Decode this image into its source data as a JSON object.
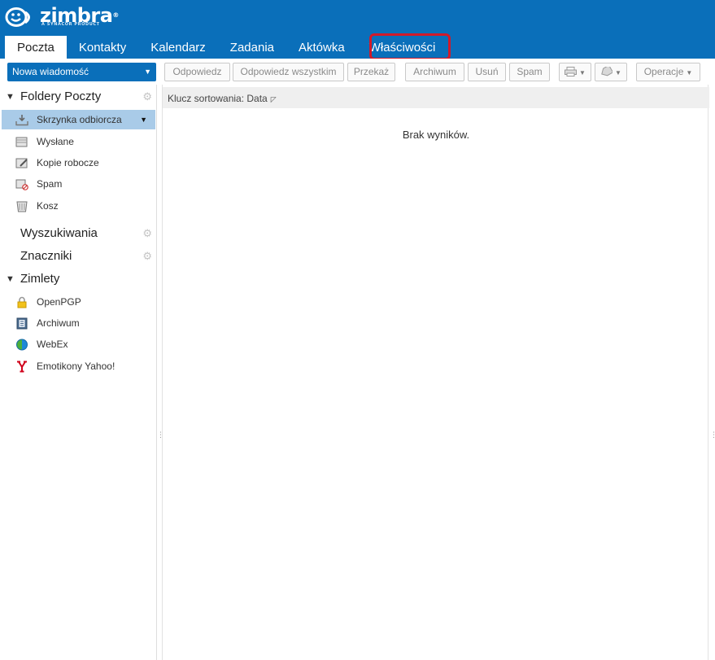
{
  "brand": {
    "name": "zimbra",
    "registered": "®",
    "tagline": "A SYNACOR PRODUCT",
    "color": "#0a6fba"
  },
  "tabs": [
    {
      "label": "Poczta",
      "active": true
    },
    {
      "label": "Kontakty",
      "active": false
    },
    {
      "label": "Kalendarz",
      "active": false
    },
    {
      "label": "Zadania",
      "active": false
    },
    {
      "label": "Aktówka",
      "active": false
    },
    {
      "label": "Właściwości",
      "active": false,
      "highlighted": true
    }
  ],
  "toolbar": {
    "new_message": "Nowa wiadomość",
    "reply": "Odpowiedz",
    "reply_all": "Odpowiedz wszystkim",
    "forward": "Przekaż",
    "archive": "Archiwum",
    "delete": "Usuń",
    "spam": "Spam",
    "print_icon": "printer-icon",
    "tag_icon": "tag-icon",
    "actions": "Operacje"
  },
  "sidebar": {
    "mail_folders": {
      "title": "Foldery Poczty",
      "items": [
        {
          "label": "Skrzynka odbiorcza",
          "icon": "inbox-icon",
          "selected": true
        },
        {
          "label": "Wysłane",
          "icon": "sent-icon"
        },
        {
          "label": "Kopie robocze",
          "icon": "drafts-icon"
        },
        {
          "label": "Spam",
          "icon": "spam-icon"
        },
        {
          "label": "Kosz",
          "icon": "trash-icon"
        }
      ]
    },
    "searches": {
      "title": "Wyszukiwania"
    },
    "tags": {
      "title": "Znaczniki"
    },
    "zimlets": {
      "title": "Zimlety",
      "items": [
        {
          "label": "OpenPGP",
          "icon": "lock-icon"
        },
        {
          "label": "Archiwum",
          "icon": "archive-icon"
        },
        {
          "label": "WebEx",
          "icon": "globe-icon"
        },
        {
          "label": "Emotikony Yahoo!",
          "icon": "yahoo-icon"
        }
      ]
    }
  },
  "main": {
    "sort_label": "Klucz sortowania: Data",
    "empty_message": "Brak wyników."
  }
}
